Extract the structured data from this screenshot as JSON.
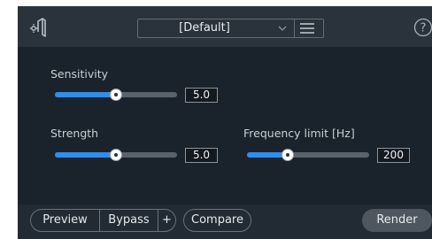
{
  "header": {
    "preset_name": "[Default]",
    "logo_icon": "logo-icon",
    "menu_icon": "hamburger-menu-icon",
    "chevron_icon": "chevron-down-icon",
    "help_icon": "question-mark-icon",
    "help_label": "?"
  },
  "controls": {
    "sensitivity": {
      "label": "Sensitivity",
      "value": "5.0",
      "level": 0.5
    },
    "strength": {
      "label": "Strength",
      "value": "5.0",
      "level": 0.5
    },
    "frequency_limit": {
      "label": "Frequency limit [Hz]",
      "value": "200",
      "level": 0.33
    }
  },
  "footer": {
    "preview_label": "Preview",
    "bypass_label": "Bypass",
    "plus_label": "+",
    "compare_label": "Compare",
    "render_label": "Render"
  },
  "colors": {
    "accent": "#2a8ff5",
    "panel_bg": "#1a232b",
    "header_bg": "#2a333b"
  }
}
